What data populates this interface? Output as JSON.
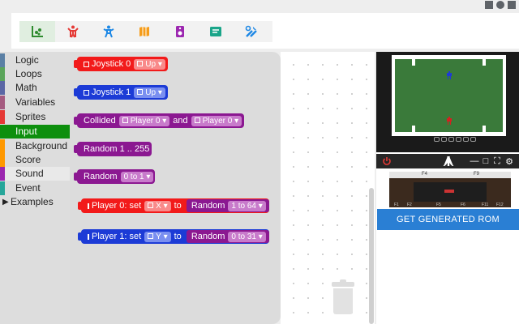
{
  "toolbar": {
    "buttons": [
      {
        "icon": "program-blocks-icon",
        "color": "#2e8b2e",
        "active": true
      },
      {
        "icon": "player-red-icon",
        "color": "#e53935"
      },
      {
        "icon": "player-blue-icon",
        "color": "#1e88e5"
      },
      {
        "icon": "map-icon",
        "color": "#f59c1a"
      },
      {
        "icon": "speaker-icon",
        "color": "#9c27b0"
      },
      {
        "icon": "message-icon",
        "color": "#1aa589"
      },
      {
        "icon": "tools-icon",
        "color": "#1e88e5"
      }
    ]
  },
  "categories": [
    {
      "label": "Logic",
      "color": "#5b80a5"
    },
    {
      "label": "Loops",
      "color": "#5ba55b"
    },
    {
      "label": "Math",
      "color": "#5b67a5"
    },
    {
      "label": "Variables",
      "color": "#a55b80"
    },
    {
      "label": "Sprites",
      "color": "#e53935"
    },
    {
      "label": "Input",
      "color": "#0d8f0d",
      "selected": true
    },
    {
      "label": "Background",
      "color": "#ff9800"
    },
    {
      "label": "Score",
      "color": "#ff9800"
    },
    {
      "label": "Sound",
      "color": "#9c27b0"
    },
    {
      "label": "Event",
      "color": "#26a69a"
    },
    {
      "label": "Examples",
      "color": ""
    }
  ],
  "blocks": {
    "joystick0": {
      "label": "Joystick 0",
      "dir": "Up"
    },
    "joystick1": {
      "label": "Joystick 1",
      "dir": "Up"
    },
    "collided": {
      "label": "Collided",
      "a": "Player 0",
      "and": "and",
      "b": "Player 0"
    },
    "random_255": {
      "label": "Random 1 .. 255"
    },
    "random_01": {
      "label": "Random",
      "range": "0 to 1"
    },
    "p0set": {
      "label": "Player 0: set",
      "axis": "X",
      "to": "to",
      "rand": "Random",
      "range": "1 to 64"
    },
    "p1set": {
      "label": "Player 1: set",
      "axis": "Y",
      "to": "to",
      "rand": "Random",
      "range": "0 to 31"
    }
  },
  "console": {
    "f4": "F4",
    "f9": "F9",
    "keys": [
      "F1",
      "F2",
      "F5",
      "F6",
      "F11",
      "F12"
    ]
  },
  "rom_button": "GET GENERATED ROM"
}
